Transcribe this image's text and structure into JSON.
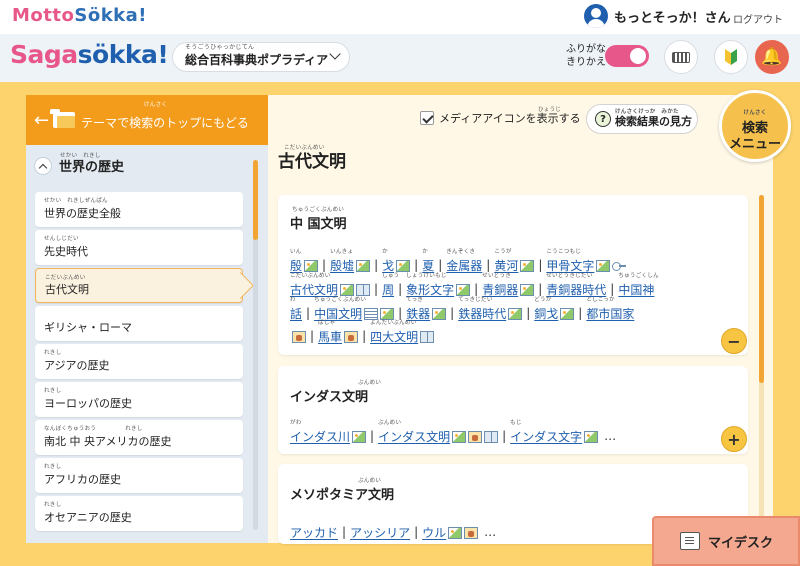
{
  "topbar": {
    "logo_main": "Motto",
    "logo_accent": "Sökka!",
    "username": "もっとそっか！さん",
    "logout": "ログアウト"
  },
  "header": {
    "logo_main": "Saga",
    "logo_accent": "sökka!",
    "dictionary_ruby": "そうごうひゃっかじてん",
    "dictionary": "総合百科事典ポプラディア",
    "furigana_toggle_label_1": "ふりがな",
    "furigana_toggle_label_2": "きりかえ",
    "furigana_on": true
  },
  "left": {
    "back_label": "テーマで検索のトップにもどる",
    "back_ruby": "けんさく",
    "section_title": "世界の歴史",
    "section_ruby": "せかい　れきし",
    "items": [
      {
        "label": "世界の歴史全般",
        "ruby": "せかい　れきしぜんぱん"
      },
      {
        "label": "先史時代",
        "ruby": "せんしじだい"
      },
      {
        "label": "古代文明",
        "ruby": "こだいぶんめい"
      },
      {
        "label": "ギリシャ・ローマ",
        "ruby": ""
      },
      {
        "label": "アジアの歴史",
        "ruby": "れきし"
      },
      {
        "label": "ヨーロッパの歴史",
        "ruby": "れきし"
      },
      {
        "label": "南北 中 央アメリカの歴史",
        "ruby": "なんぼくちゅうおう　　　　　れきし"
      },
      {
        "label": "アフリカの歴史",
        "ruby": "れきし"
      },
      {
        "label": "オセアニアの歴史",
        "ruby": "れきし"
      }
    ],
    "active_index": 2
  },
  "right": {
    "media_toggle": "メディアアイコンを表示する",
    "media_ruby": "ひょうじ",
    "howto": "検索結果の見方",
    "howto_ruby": "けんさくけっか　みかた",
    "search_menu_ruby": "けんさく",
    "search_menu_1": "検索",
    "search_menu_2": "メニュー",
    "page_title": "古代文明",
    "page_title_ruby": "こだいぶんめい",
    "mydesk": "マイデスク",
    "sections": [
      {
        "title": "中 国文明",
        "title_ruby": "ちゅうごくぶんめい",
        "button": "−",
        "rows": [
          [
            {
              "w": "殷",
              "r": "いん",
              "ic": [
                "img"
              ]
            },
            {
              "w": "殷墟",
              "r": "いんきょ",
              "ic": [
                "img"
              ]
            },
            {
              "w": "戈",
              "r": "か",
              "ic": [
                "img"
              ]
            },
            {
              "w": "夏",
              "r": "か",
              "ic": []
            },
            {
              "w": "金属器",
              "r": "きんぞくき",
              "ic": []
            },
            {
              "w": "黄河",
              "r": "こうが",
              "ic": [
                "img"
              ]
            },
            {
              "w": "甲骨文字",
              "r": "こうこつもじ",
              "ic": [
                "img",
                "key"
              ]
            }
          ],
          [
            {
              "w": "古代文明",
              "r": "こだいぶんめい",
              "ic": [
                "img",
                "book"
              ]
            },
            {
              "w": "周",
              "r": "しゅう",
              "ic": []
            },
            {
              "w": "象形文字",
              "r": "しょうけいもじ",
              "ic": [
                "img"
              ]
            },
            {
              "w": "青銅器",
              "r": "せいどうき",
              "ic": [
                "img"
              ]
            },
            {
              "w": "青銅器時代",
              "r": "せいどうきじだい",
              "ic": []
            },
            {
              "w": "中国神",
              "r": "ちゅうごくしん",
              "ic": []
            }
          ],
          [
            {
              "w": "話",
              "r": "わ",
              "ic": []
            },
            {
              "w": "中国文明",
              "r": "ちゅうごくぶんめい",
              "ic": [
                "list",
                "img"
              ]
            },
            {
              "w": "鉄器",
              "r": "てっき",
              "ic": [
                "img"
              ]
            },
            {
              "w": "鉄器時代",
              "r": "てっきじだい",
              "ic": [
                "img"
              ]
            },
            {
              "w": "銅戈",
              "r": "どうか",
              "ic": [
                "img"
              ]
            },
            {
              "w": "都市国家",
              "r": "としこっか",
              "ic": []
            }
          ],
          [
            {
              "w": "",
              "r": "",
              "ic": [
                "pic"
              ]
            },
            {
              "w": "馬車",
              "r": "ばしゃ",
              "ic": [
                "pic"
              ]
            },
            {
              "w": "四大文明",
              "r": "よんだいぶんめい",
              "ic": [
                "book"
              ]
            }
          ]
        ]
      },
      {
        "title": "インダス文明",
        "title_ruby": "ぶんめい",
        "button": "+",
        "more": "…",
        "rows": [
          [
            {
              "w": "インダス川",
              "r": "がわ",
              "ic": [
                "img"
              ]
            },
            {
              "w": "インダス文明",
              "r": "ぶんめい",
              "ic": [
                "img",
                "pic",
                "book"
              ]
            },
            {
              "w": "インダス文字",
              "r": "もじ",
              "ic": [
                "img"
              ]
            }
          ]
        ]
      },
      {
        "title": "メソポタミア文明",
        "title_ruby": "ぶんめい",
        "button": "",
        "more": "…",
        "rows": [
          [
            {
              "w": "アッカド",
              "r": "",
              "ic": []
            },
            {
              "w": "アッシリア",
              "r": "",
              "ic": []
            },
            {
              "w": "ウル",
              "r": "",
              "ic": [
                "img",
                "pic"
              ]
            }
          ]
        ]
      }
    ]
  }
}
